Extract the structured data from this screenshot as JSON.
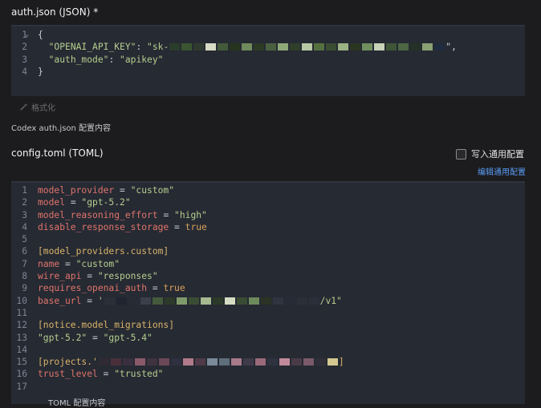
{
  "auth": {
    "title": "auth.json (JSON) *",
    "lines": [
      {
        "n": "1",
        "fold": true,
        "segs": [
          {
            "c": "punc",
            "t": "{"
          }
        ]
      },
      {
        "n": "2",
        "segs": [
          {
            "c": "punc",
            "t": "  "
          },
          {
            "c": "str",
            "t": "\"OPENAI_API_KEY\""
          },
          {
            "c": "punc",
            "t": ": "
          },
          {
            "c": "str",
            "t": "\"sk-"
          },
          {
            "c": "pix",
            "p": [
              "#2a3d2a",
              "#3b5432",
              "#2f3a2e",
              "#d8dcc6",
              "#43593a",
              "#26331f",
              "#6f8a5b",
              "#2c3a26",
              "#4a6040",
              "#8fa878",
              "#2e3f2a",
              "#b9c8a4",
              "#54703f",
              "#3a4d33",
              "#9bb284",
              "#2a3522",
              "#708e5e",
              "#c7d2b6",
              "#3f5537",
              "#4d6644",
              "#233126",
              "#8aa073",
              "#1f2b3f"
            ]
          },
          {
            "c": "punc",
            "t": "\","
          }
        ]
      },
      {
        "n": "3",
        "segs": [
          {
            "c": "punc",
            "t": "  "
          },
          {
            "c": "str",
            "t": "\"auth_mode\""
          },
          {
            "c": "punc",
            "t": ": "
          },
          {
            "c": "str",
            "t": "\"apikey\""
          }
        ]
      },
      {
        "n": "4",
        "segs": [
          {
            "c": "punc",
            "t": "}"
          }
        ]
      }
    ],
    "format_label": "格式化",
    "description": "Codex auth.json 配置内容"
  },
  "config": {
    "title": "config.toml (TOML)",
    "checkbox_label": "写入通用配置",
    "edit_link": "编辑通用配置",
    "lines": [
      {
        "n": "1",
        "segs": [
          {
            "c": "key",
            "t": "model_provider"
          },
          {
            "c": "punc",
            "t": " = "
          },
          {
            "c": "str",
            "t": "\"custom\""
          }
        ]
      },
      {
        "n": "2",
        "segs": [
          {
            "c": "key",
            "t": "model"
          },
          {
            "c": "punc",
            "t": " = "
          },
          {
            "c": "str",
            "t": "\"gpt-5.2\""
          }
        ]
      },
      {
        "n": "3",
        "segs": [
          {
            "c": "key",
            "t": "model_reasoning_effort"
          },
          {
            "c": "punc",
            "t": " = "
          },
          {
            "c": "str",
            "t": "\"high\""
          }
        ]
      },
      {
        "n": "4",
        "segs": [
          {
            "c": "key",
            "t": "disable_response_storage"
          },
          {
            "c": "punc",
            "t": " = "
          },
          {
            "c": "bool",
            "t": "true"
          }
        ]
      },
      {
        "n": "5",
        "segs": []
      },
      {
        "n": "6",
        "segs": [
          {
            "c": "sect",
            "t": "[model_providers.custom]"
          }
        ]
      },
      {
        "n": "7",
        "segs": [
          {
            "c": "key",
            "t": "name"
          },
          {
            "c": "punc",
            "t": " = "
          },
          {
            "c": "str",
            "t": "\"custom\""
          }
        ]
      },
      {
        "n": "8",
        "segs": [
          {
            "c": "key",
            "t": "wire_api"
          },
          {
            "c": "punc",
            "t": " = "
          },
          {
            "c": "str",
            "t": "\"responses\""
          }
        ]
      },
      {
        "n": "9",
        "segs": [
          {
            "c": "key",
            "t": "requires_openai_auth"
          },
          {
            "c": "punc",
            "t": " = "
          },
          {
            "c": "bool",
            "t": "true"
          }
        ]
      },
      {
        "n": "10",
        "segs": [
          {
            "c": "key",
            "t": "base_url"
          },
          {
            "c": "punc",
            "t": " = "
          },
          {
            "c": "str",
            "t": "'"
          },
          {
            "c": "pix",
            "p": [
              "#2b2f38",
              "#1f2430",
              "#262b35",
              "#3a3f4a",
              "#445a3c",
              "#2d3a2a",
              "#7f9a6a",
              "#3a4d34",
              "#a6b98f",
              "#2b3a28",
              "#d6dcc3",
              "#394b33",
              "#6e8a5c",
              "#2a3324",
              "#2e3440",
              "#262b35",
              "#2b2f38",
              "#2a2f3a"
            ]
          },
          {
            "c": "str",
            "t": "/v1\""
          }
        ]
      },
      {
        "n": "11",
        "segs": []
      },
      {
        "n": "12",
        "segs": [
          {
            "c": "sect",
            "t": "[notice.model_migrations]"
          }
        ]
      },
      {
        "n": "13",
        "segs": [
          {
            "c": "str",
            "t": "\"gpt-5.2\""
          },
          {
            "c": "punc",
            "t": " = "
          },
          {
            "c": "str",
            "t": "\"gpt-5.4\""
          }
        ]
      },
      {
        "n": "14",
        "segs": []
      },
      {
        "n": "15",
        "segs": [
          {
            "c": "sect",
            "t": "[projects.'"
          },
          {
            "c": "pix",
            "p": [
              "#2f2a33",
              "#4a2f3a",
              "#3a2f3f",
              "#8a5a6a",
              "#3f3340",
              "#6a4858",
              "#2e3040",
              "#b07a8a",
              "#4e3a48",
              "#7a8a9a",
              "#5e6e7a",
              "#a87a8a",
              "#3f3a4a",
              "#9a6a7a",
              "#2f3340",
              "#c08a9a",
              "#4a3a48",
              "#7a5a6a",
              "#2f2f3a",
              "#d4c890"
            ]
          },
          {
            "c": "sect",
            "t": "]"
          }
        ]
      },
      {
        "n": "16",
        "segs": [
          {
            "c": "key",
            "t": "trust_level"
          },
          {
            "c": "punc",
            "t": " = "
          },
          {
            "c": "str",
            "t": "\"trusted\""
          }
        ]
      },
      {
        "n": "17",
        "segs": []
      }
    ],
    "footer_fragment": "TOML 配置内容"
  },
  "colors": {
    "accent_link": "#5b9bf5",
    "string": "#b5cf8e",
    "key": "#e0746b",
    "section": "#d9b36a"
  },
  "icons": {
    "format": "magic-wand-icon",
    "fold": "chevron-down-icon"
  }
}
